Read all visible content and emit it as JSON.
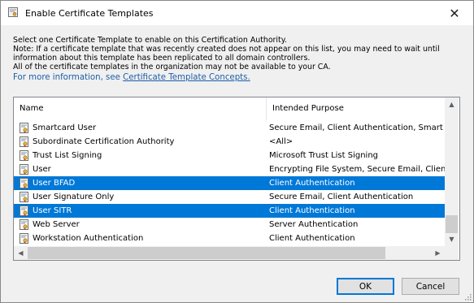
{
  "window": {
    "title": "Enable Certificate Templates",
    "close_glyph": "✕"
  },
  "description": {
    "line1": "Select one Certificate Template to enable on this Certification Authority.",
    "line2": "Note: If a certificate template that was recently created does not appear on this list, you may need to wait until",
    "line3": "information about this template has been replicated to all domain controllers.",
    "line4": "All of the certificate templates in the organization may not be available to your CA.",
    "info_prefix": "For more information, see ",
    "info_link": "Certificate Template Concepts."
  },
  "list": {
    "columns": {
      "name": "Name",
      "purpose": "Intended Purpose"
    },
    "rows": [
      {
        "name": "Smartcard User",
        "purpose": "Secure Email, Client Authentication, Smart Ca",
        "selected": false
      },
      {
        "name": "Subordinate Certification Authority",
        "purpose": "<All>",
        "selected": false
      },
      {
        "name": "Trust List Signing",
        "purpose": "Microsoft Trust List Signing",
        "selected": false
      },
      {
        "name": "User",
        "purpose": "Encrypting File System, Secure Email, Client A",
        "selected": false
      },
      {
        "name": "User BFAD",
        "purpose": "Client Authentication",
        "selected": true
      },
      {
        "name": "User Signature Only",
        "purpose": "Secure Email, Client Authentication",
        "selected": false
      },
      {
        "name": "User SITR",
        "purpose": "Client Authentication",
        "selected": true
      },
      {
        "name": "Web Server",
        "purpose": "Server Authentication",
        "selected": false
      },
      {
        "name": "Workstation Authentication",
        "purpose": "Client Authentication",
        "selected": false
      }
    ],
    "row_icon": "certificate-template-icon"
  },
  "buttons": {
    "ok": "OK",
    "cancel": "Cancel"
  },
  "colors": {
    "selection": "#0078d7",
    "link": "#1c5fa8"
  }
}
